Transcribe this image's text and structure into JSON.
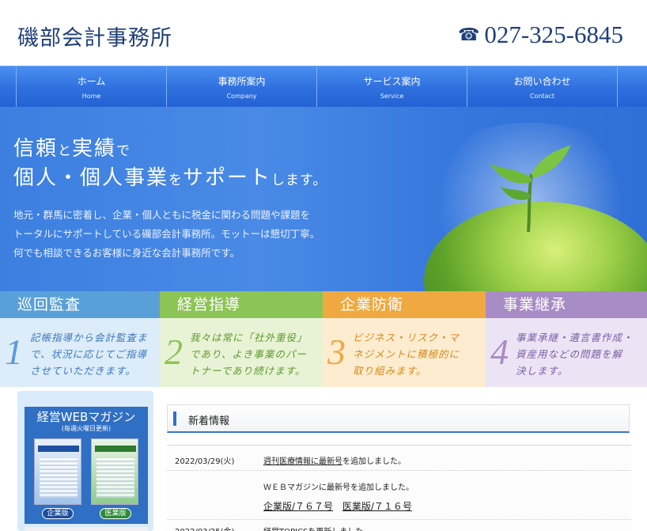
{
  "header": {
    "site_title": "磯部会計事務所",
    "phone": "027-325-6845",
    "phone_icon": "phone-icon"
  },
  "nav": {
    "items": [
      {
        "jp": "ホーム",
        "en": "Home"
      },
      {
        "jp": "事務所案内",
        "en": "Company"
      },
      {
        "jp": "サービス案内",
        "en": "Service"
      },
      {
        "jp": "お問い合わせ",
        "en": "Contact"
      }
    ]
  },
  "hero": {
    "line1_a": "信頼",
    "line1_b": "と",
    "line1_c": "実績",
    "line1_d": "で",
    "line2_a": "個人・個人事業",
    "line2_b": "を",
    "line2_c": "サポート",
    "line2_d": "します。",
    "p1": "地元・群馬に密着し、企業・個人ともに税金に関わる問題や課題を",
    "p2": "トータルにサポートしている磯部会計事務所。モットーは懇切丁寧。",
    "p3": "何でも相談できるお客様に身近な会計事務所です。"
  },
  "services": [
    {
      "title": "巡回監査",
      "num": "1",
      "l1": "記帳指導から会計監査ま",
      "l2": "で、状況に応じてご指導",
      "l3": "させていただきます。",
      "head_color": "#5aa0d8",
      "body_color": "#dcecf8",
      "text_color": "#3a78c0"
    },
    {
      "title": "経営指導",
      "num": "2",
      "l1": "我々は常に「社外重役」",
      "l2": "であり、よき事業のパー",
      "l3": "トナーであり続けます。",
      "head_color": "#8cc455",
      "body_color": "#e8f3d6",
      "text_color": "#5e9a2a"
    },
    {
      "title": "企業防衛",
      "num": "3",
      "l1": "ビジネス・リスク・マ",
      "l2": "ネジメントに積極的に",
      "l3": "取り組みます。",
      "head_color": "#f0a940",
      "body_color": "#fdecd0",
      "text_color": "#d68a1a"
    },
    {
      "title": "事業継承",
      "num": "4",
      "l1": "事業承継・遺言書作成・",
      "l2": "資産用などの問題を解",
      "l3": "決します。",
      "head_color": "#a88cc6",
      "body_color": "#ece4f4",
      "text_color": "#7a5ea6"
    }
  ],
  "magazine": {
    "title": "経営WEBマガジン",
    "subtitle": "(毎週火曜日更新)",
    "btn1": "企業版",
    "btn2": "医業版"
  },
  "news": {
    "heading": "新着情報",
    "rows": [
      {
        "date": "2022/03/29(火)",
        "link": "週刊医療情報に最新号",
        "tail": "を追加しました。"
      },
      {
        "date": "",
        "text": "ＷＥＢマガジンに最新号を追加しました。",
        "link1": "企業版/７６７号",
        "link2": "医業版/７１６号"
      },
      {
        "date": "2022/03/25(金)",
        "text": "経営TOPICSを更新しました"
      }
    ]
  }
}
